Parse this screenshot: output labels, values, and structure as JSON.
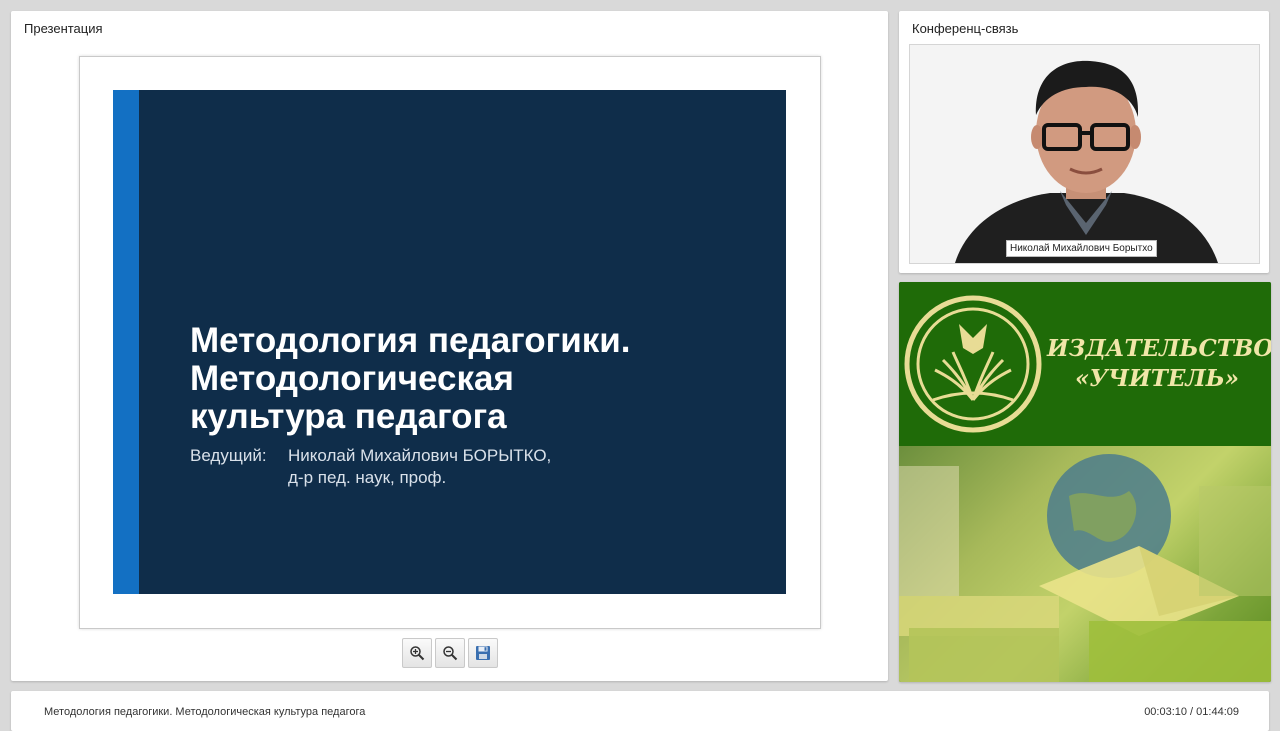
{
  "presentation": {
    "title": "Презентация",
    "slide": {
      "title_lines": [
        "Методология педагогики.",
        "Методологическая",
        "культура педагога"
      ],
      "presenter_label": "Ведущий:",
      "presenter_name": "Николай Михайлович БОРЫТКО,",
      "presenter_degree": "д-р пед. наук, проф."
    },
    "toolbar": {
      "zoom_in_icon": "zoom-in-icon",
      "zoom_out_icon": "zoom-out-icon",
      "save_icon": "save-icon"
    }
  },
  "conference": {
    "title": "Конференц-связь",
    "speaker_caption": "Николай Михайлович Борытхо"
  },
  "ad": {
    "line1": "ИЗДАТЕЛЬСТВО",
    "line2": "«УЧИТЕЛЬ»"
  },
  "footer": {
    "title": "Методология педагогики. Методологическая культура педагога",
    "time": "00:03:10 / 01:44:09"
  },
  "colors": {
    "slide_background": "#0f2d4a",
    "slide_accent": "#1370c3",
    "ad_green": "#1f6b08",
    "ad_text": "#f0e6a8"
  }
}
